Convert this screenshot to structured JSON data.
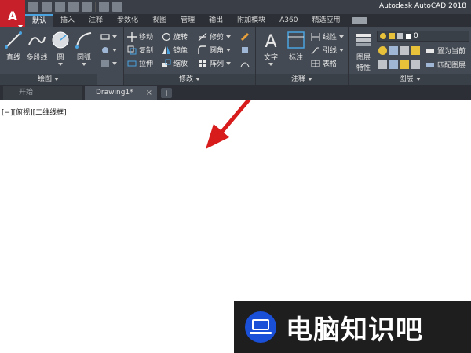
{
  "window": {
    "title": "Autodesk AutoCAD 2018",
    "app_logo": "A"
  },
  "quick_access": [
    "new-icon",
    "open-icon",
    "save-icon",
    "save-as-icon",
    "print-icon",
    "undo-icon",
    "redo-icon"
  ],
  "ribbon_tabs": [
    {
      "label": "默认",
      "active": true
    },
    {
      "label": "插入"
    },
    {
      "label": "注释"
    },
    {
      "label": "参数化"
    },
    {
      "label": "视图"
    },
    {
      "label": "管理"
    },
    {
      "label": "输出"
    },
    {
      "label": "附加模块"
    },
    {
      "label": "A360"
    },
    {
      "label": "精选应用"
    }
  ],
  "panels": {
    "draw": {
      "label": "绘图",
      "line": "直线",
      "polyline": "多段线",
      "circle": "圆",
      "arc": "圆弧"
    },
    "modify": {
      "label": "修改",
      "move": "移动",
      "rotate": "旋转",
      "trim": "修剪",
      "copy": "复制",
      "mirror": "镜像",
      "fillet": "圆角",
      "stretch": "拉伸",
      "scale": "缩放",
      "array": "阵列"
    },
    "annotation": {
      "label": "注释",
      "text": "文字",
      "dimension": "标注",
      "linear": "线性",
      "leader": "引线",
      "table": "表格"
    },
    "layers": {
      "label": "图层",
      "properties_line1": "图层",
      "properties_line2": "特性",
      "layer_value": "0",
      "set_current": "置为当前",
      "match_layer": "匹配图层"
    }
  },
  "doc_tabs": {
    "start": "开始",
    "drawing": "Drawing1*"
  },
  "viewport": {
    "label": "[−][俯视][二维线框]"
  },
  "watermark": {
    "text": "电脑知识吧"
  },
  "colors": {
    "ribbon_bg": "#434a53",
    "title_bg": "#3a3f47",
    "logo_red": "#c8202a",
    "arrow_red": "#d81b1b",
    "watermark_blue": "#1a4fd8"
  }
}
